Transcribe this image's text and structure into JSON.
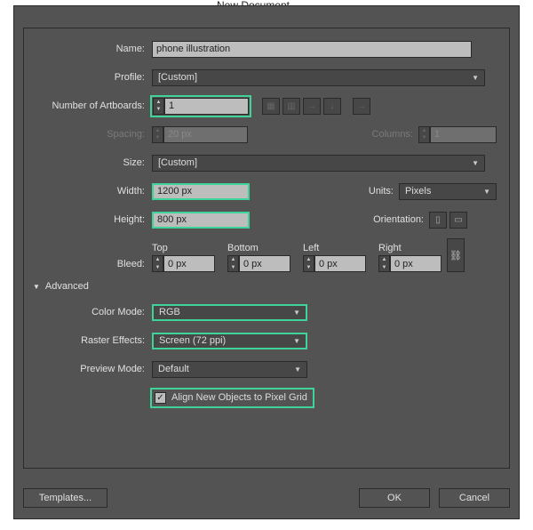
{
  "title": "New Document",
  "fields": {
    "name_label": "Name:",
    "name_value": "phone illustration",
    "profile_label": "Profile:",
    "profile_value": "[Custom]",
    "artboards_label": "Number of Artboards:",
    "artboards_value": "1",
    "spacing_label": "Spacing:",
    "spacing_value": "20 px",
    "columns_label": "Columns:",
    "columns_value": "1",
    "size_label": "Size:",
    "size_value": "[Custom]",
    "width_label": "Width:",
    "width_value": "1200 px",
    "units_label": "Units:",
    "units_value": "Pixels",
    "height_label": "Height:",
    "height_value": "800 px",
    "orientation_label": "Orientation:",
    "bleed_label": "Bleed:",
    "bleed_top": "Top",
    "bleed_bottom": "Bottom",
    "bleed_left": "Left",
    "bleed_right": "Right",
    "bleed_val": "0 px"
  },
  "advanced": {
    "heading": "Advanced",
    "color_mode_label": "Color Mode:",
    "color_mode_value": "RGB",
    "raster_label": "Raster Effects:",
    "raster_value": "Screen (72 ppi)",
    "preview_label": "Preview Mode:",
    "preview_value": "Default",
    "align_label": "Align New Objects to Pixel Grid"
  },
  "buttons": {
    "templates": "Templates...",
    "ok": "OK",
    "cancel": "Cancel"
  }
}
